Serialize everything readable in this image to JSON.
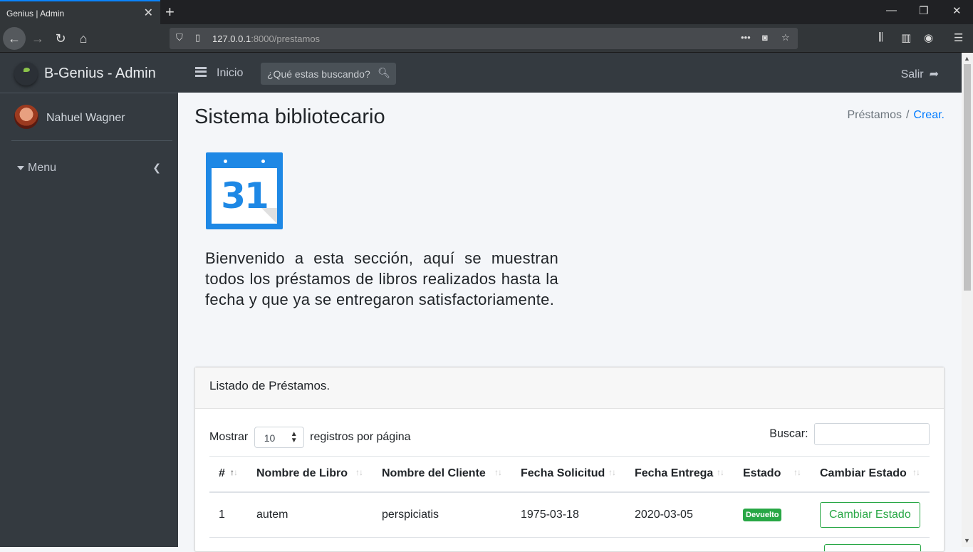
{
  "browser": {
    "tab_title": "Genius | Admin",
    "url_host": "127.0.0.1",
    "url_path": ":8000/prestamos"
  },
  "sidebar": {
    "brand": "B-Genius - Admin",
    "user_name": "Nahuel Wagner",
    "menu_label": "Menu"
  },
  "topnav": {
    "home_label": "Inicio",
    "search_placeholder": "¿Qué estas buscando?",
    "logout_label": "Salir"
  },
  "page": {
    "title": "Sistema bibliotecario",
    "breadcrumb": [
      "Préstamos",
      "Crear."
    ],
    "calendar_day": "31",
    "welcome_text": "Bienvenido a esta sección, aquí se muestran todos los préstamos de libros realizados hasta la fecha y que ya se entregaron satisfactoriamente."
  },
  "listing": {
    "title": "Listado de Préstamos.",
    "show_label": "Mostrar",
    "page_size": "10",
    "per_page_label": "registros por página",
    "search_label": "Buscar:",
    "columns": [
      "#",
      "Nombre de Libro",
      "Nombre del Cliente",
      "Fecha Solicitud",
      "Fecha Entrega",
      "Estado",
      "Cambiar Estado"
    ],
    "rows": [
      {
        "id": "1",
        "book": "autem",
        "client": "perspiciatis",
        "requested": "1975-03-18",
        "delivered": "2020-03-05",
        "status": "Devuelto",
        "action": "Cambiar Estado"
      }
    ]
  },
  "colors": {
    "sidebar": "#343a40",
    "accent": "#007bff",
    "success": "#28a745"
  }
}
